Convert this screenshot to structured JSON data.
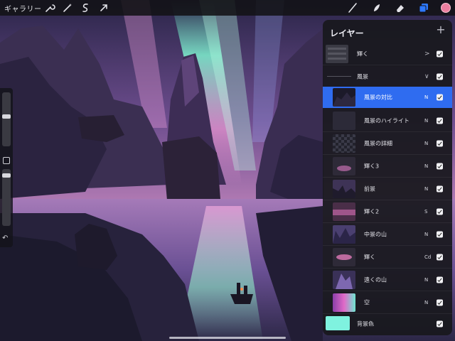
{
  "toolbar": {
    "gallery_label": "ギャラリー",
    "left_tools": [
      "wrench-icon",
      "magic-wand-icon",
      "selection-icon",
      "transform-arrow-icon"
    ],
    "right_tools": [
      "brush-icon",
      "smudge-icon",
      "eraser-icon",
      "layers-icon"
    ],
    "active_tool": "layers-icon",
    "current_color": "#ec7f9f"
  },
  "sidebar": {
    "brush_size_level": 0.2,
    "opacity_level": 0.15,
    "undo_icon": "undo-icon"
  },
  "layers_panel": {
    "title": "レイヤー",
    "add_icon": "plus-icon",
    "selected_color": "#2f6cf0",
    "layers": [
      {
        "name": "輝く",
        "kind": "group",
        "toggle": ">",
        "visible": true
      },
      {
        "name": "風景",
        "kind": "group-open",
        "toggle": "∨",
        "visible": true
      },
      {
        "name": "風景の対比",
        "blend": "N",
        "visible": true,
        "selected": true
      },
      {
        "name": "風景のハイライト",
        "blend": "N",
        "visible": true
      },
      {
        "name": "風景の詳細",
        "blend": "N",
        "visible": true
      },
      {
        "name": "輝く3",
        "blend": "N",
        "visible": true
      },
      {
        "name": "前景",
        "blend": "N",
        "visible": true
      },
      {
        "name": "輝く2",
        "blend": "S",
        "visible": true
      },
      {
        "name": "中景の山",
        "blend": "N",
        "visible": true
      },
      {
        "name": "輝く",
        "blend": "Cd",
        "visible": true
      },
      {
        "name": "遠くの山",
        "blend": "N",
        "visible": true
      },
      {
        "name": "空",
        "blend": "N",
        "visible": true
      }
    ],
    "background": {
      "name": "背景色",
      "color": "#7ff2df",
      "visible": true
    }
  }
}
